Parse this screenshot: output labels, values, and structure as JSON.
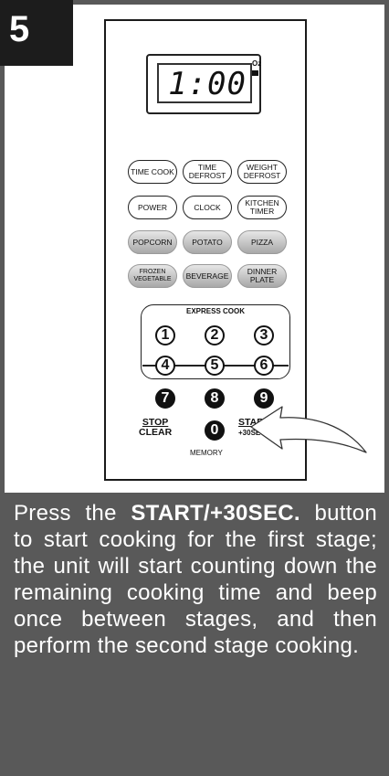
{
  "step": "5",
  "display": {
    "time": "1:00",
    "oz_label": "Oz"
  },
  "keys": [
    {
      "label": "TIME COOK",
      "style": "outline"
    },
    {
      "label": "TIME DEFROST",
      "style": "outline"
    },
    {
      "label": "WEIGHT DEFROST",
      "style": "outline"
    },
    {
      "label": "POWER",
      "style": "outline"
    },
    {
      "label": "CLOCK",
      "style": "outline"
    },
    {
      "label": "KITCHEN TIMER",
      "style": "outline"
    },
    {
      "label": "POPCORN",
      "style": "grey"
    },
    {
      "label": "POTATO",
      "style": "grey"
    },
    {
      "label": "PIZZA",
      "style": "grey"
    },
    {
      "label": "FROZEN VEGETABLE",
      "style": "grey"
    },
    {
      "label": "BEVERAGE",
      "style": "grey"
    },
    {
      "label": "DINNER PLATE",
      "style": "grey"
    }
  ],
  "express_cook_label": "EXPRESS COOK",
  "numbers": [
    "1",
    "2",
    "3",
    "4",
    "5",
    "6",
    "7",
    "8",
    "9",
    "0"
  ],
  "stop": {
    "line1": "STOP",
    "line2": "CLEAR"
  },
  "start": {
    "line1": "START",
    "line2": "+30SEC."
  },
  "memory_label": "MEMORY",
  "instruction": {
    "pre": "Press the ",
    "bold": "START/+30SEC.",
    "post": " button to start cooking for the first stage; the unit will start counting down the remaining cooking time and beep once between stages, and then perform the second stage cooking."
  },
  "colors": {
    "badge": "#1c1c1c",
    "text_panel": "#595959",
    "frame": "#595959"
  }
}
